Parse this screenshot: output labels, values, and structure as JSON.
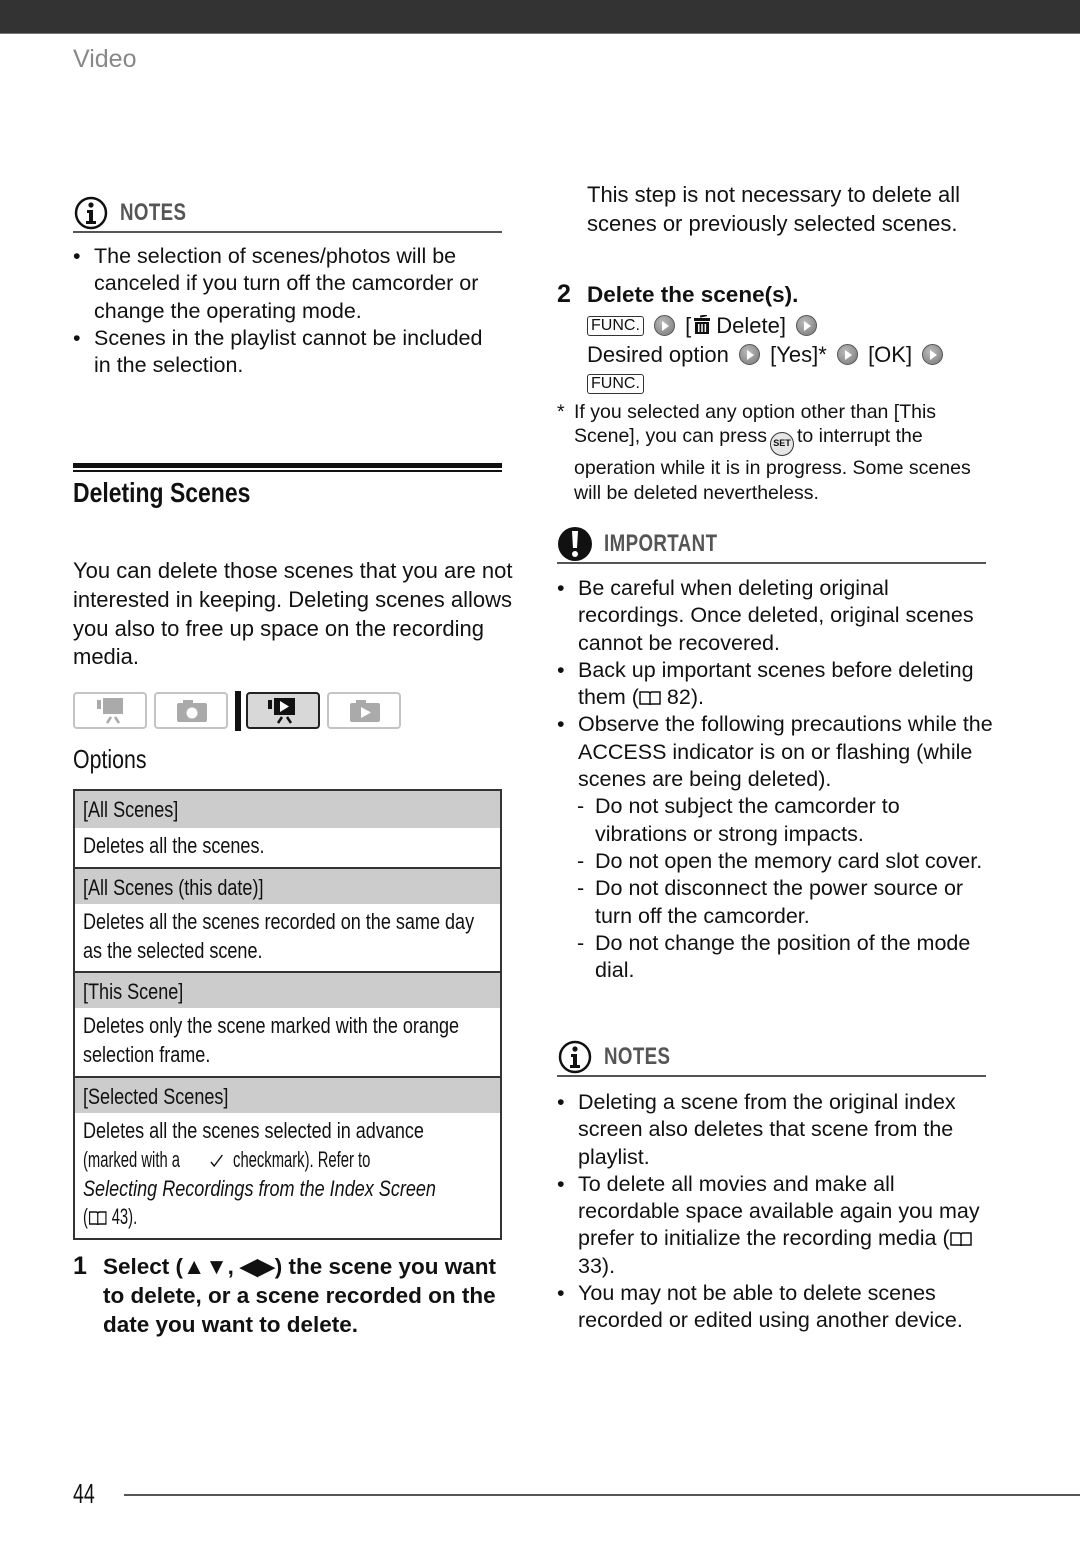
{
  "header": {
    "section_label": "Video"
  },
  "left_notes": {
    "title": "NOTES",
    "icon": "info-icon",
    "items": [
      "The selection of scenes/photos will be canceled if you turn off the camcorder or change the operating mode.",
      "Scenes in the playlist cannot be included in the selection."
    ]
  },
  "deleting_scenes": {
    "heading": "Deleting Scenes",
    "intro": "You can delete those scenes that you are not interested in keeping. Deleting scenes allows you also to free up space on the recording media.",
    "modes": [
      {
        "name": "movie-record-mode-icon",
        "active": false
      },
      {
        "name": "photo-record-mode-icon",
        "active": false
      },
      {
        "name": "movie-playback-mode-icon",
        "active": true
      },
      {
        "name": "photo-playback-mode-icon",
        "active": false
      }
    ],
    "options_heading": "Options",
    "options": [
      {
        "name": "[All Scenes]",
        "desc_lines": [
          "Deletes all the scenes."
        ]
      },
      {
        "name": "[All Scenes (this date)]",
        "desc_lines": [
          "Deletes all the scenes recorded on the same day",
          "as the selected scene."
        ]
      },
      {
        "name": "[This Scene]",
        "desc_lines": [
          "Deletes only the scene marked with the orange",
          "selection frame."
        ]
      },
      {
        "name": "[Selected Scenes]",
        "desc_lines": [
          "Deletes all the scenes selected in advance"
        ],
        "desc_mark_prefix": "(marked with a",
        "desc_mark_icon": "checkmark-icon",
        "desc_mark_suffix": "checkmark). Refer to",
        "desc_italic": "Selecting Recordings from the Index Screen",
        "desc_ref_prefix": "(",
        "desc_ref_page": "43)."
      }
    ]
  },
  "step1": {
    "number": "1",
    "text_before": "Select (",
    "arrows_ud": "▲▼",
    "sep": ", ",
    "arrows_lr": "◀▶",
    "text_after": ") the scene you want to delete, or a scene recorded on the date you want to delete."
  },
  "step1_note": "This step is not necessary to delete all scenes or previously selected scenes.",
  "step2": {
    "number": "2",
    "title": "Delete the scene(s).",
    "func_key": "FUNC.",
    "delete_item_open": "[",
    "delete_item_label": "Delete]",
    "desired_option": "Desired option",
    "yes": "[Yes]*",
    "ok": "[OK]",
    "func_key_end": "FUNC."
  },
  "footnote": {
    "marker": "*",
    "text_before": "If you selected any option other than [This Scene], you can press",
    "button": "SET",
    "text_after": "to interrupt the operation while it is in progress. Some scenes will be deleted nevertheless."
  },
  "important": {
    "title": "IMPORTANT",
    "icon": "exclamation-icon",
    "items": [
      {
        "text": "Be careful when deleting original recordings. Once deleted, original scenes cannot be recovered.",
        "type": "bullet"
      },
      {
        "text_before": "Back up important scenes before deleting them (",
        "ref": "82).",
        "type": "bullet-ref"
      },
      {
        "text": "Observe the following precautions while the ACCESS indicator is on or flashing (while scenes are being deleted).",
        "type": "bullet"
      },
      {
        "text": "Do not subject the camcorder to vibrations or strong impacts.",
        "type": "dash"
      },
      {
        "text": "Do not open the memory card slot cover.",
        "type": "dash"
      },
      {
        "text": "Do not disconnect the power source or turn off the camcorder.",
        "type": "dash"
      },
      {
        "text": "Do not change the position of the mode dial.",
        "type": "dash"
      }
    ]
  },
  "right_notes": {
    "title": "NOTES",
    "icon": "info-icon",
    "items": [
      {
        "text": "Deleting a scene from the original index screen also deletes that scene from the playlist."
      },
      {
        "text_before": "To delete all movies and make all recordable space available again you may prefer to initialize the recording media (",
        "ref": "33)."
      },
      {
        "text": "You may not be able to delete scenes recorded or edited using another device."
      }
    ]
  },
  "footer": {
    "page_number": "44"
  }
}
